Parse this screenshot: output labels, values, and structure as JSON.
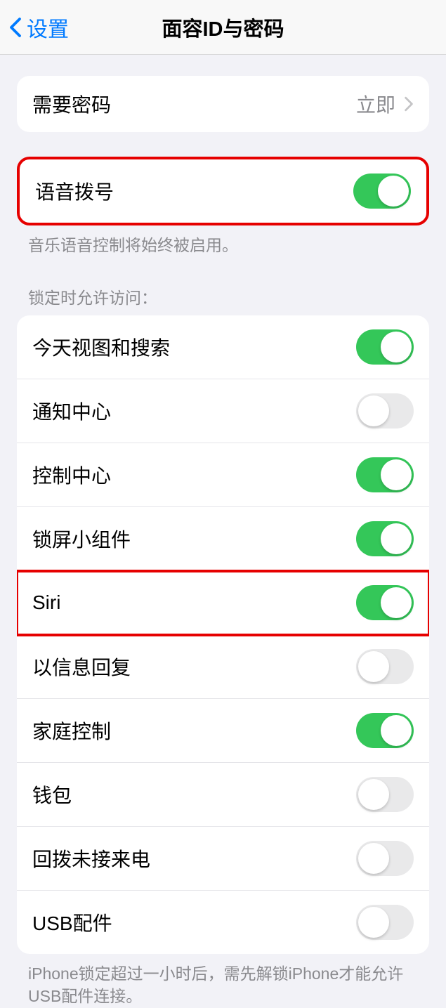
{
  "nav": {
    "back_label": "设置",
    "title": "面容ID与密码"
  },
  "require_passcode": {
    "label": "需要密码",
    "value": "立即"
  },
  "voice_dial": {
    "label": "语音拨号",
    "footer": "音乐语音控制将始终被启用。"
  },
  "lock_access": {
    "header": "锁定时允许访问：",
    "items": [
      {
        "label": "今天视图和搜索",
        "on": true
      },
      {
        "label": "通知中心",
        "on": false
      },
      {
        "label": "控制中心",
        "on": true
      },
      {
        "label": "锁屏小组件",
        "on": true
      },
      {
        "label": "Siri",
        "on": true
      },
      {
        "label": "以信息回复",
        "on": false
      },
      {
        "label": "家庭控制",
        "on": true
      },
      {
        "label": "钱包",
        "on": false
      },
      {
        "label": "回拨未接来电",
        "on": false
      },
      {
        "label": "USB配件",
        "on": false
      }
    ],
    "footer": "iPhone锁定超过一小时后，需先解锁iPhone才能允许USB配件连接。"
  }
}
